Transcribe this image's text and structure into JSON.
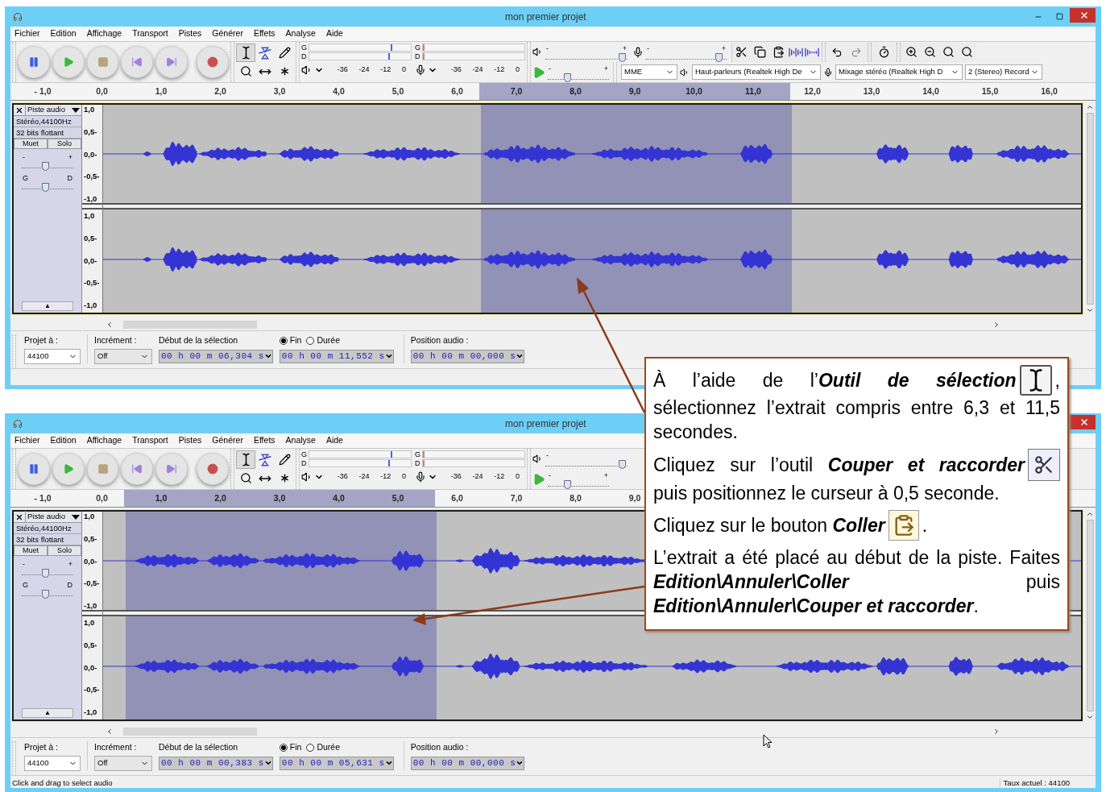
{
  "windows": [
    {
      "title": "mon premier projet",
      "controls": [
        {
          "kind": "minimize"
        },
        {
          "kind": "maximize"
        },
        {
          "kind": "close"
        }
      ],
      "menu": [
        "Fichier",
        "Edition",
        "Affichage",
        "Transport",
        "Pistes",
        "Générer",
        "Effets",
        "Analyse",
        "Aide"
      ],
      "tools": [
        {
          "kind": "select",
          "selected": true
        },
        {
          "kind": "envelope",
          "selected": false
        },
        {
          "kind": "draw",
          "selected": false
        },
        {
          "kind": "zoom",
          "selected": false
        },
        {
          "kind": "timeshift",
          "selected": false
        },
        {
          "kind": "multi",
          "selected": false
        }
      ],
      "meters": [
        {
          "kind": "playback",
          "channels": [
            {
              "label": "G",
              "level": 0.8
            },
            {
              "label": "D",
              "level": 0.78
            }
          ],
          "ticks": [
            "-36",
            "-24",
            "-12",
            "0"
          ]
        },
        {
          "kind": "record",
          "channels": [
            {
              "label": "G",
              "level": 0
            },
            {
              "label": "D",
              "level": 0
            }
          ],
          "ticks": [
            "-36",
            "-24",
            "-12",
            "0"
          ]
        }
      ],
      "mixer": [
        {
          "kind": "output",
          "min": "-",
          "max": "+",
          "level": 0.93
        },
        {
          "kind": "input",
          "min": "-",
          "max": "+",
          "level": 0.9
        }
      ],
      "edit_toolbars": true,
      "speed": {
        "min": "-",
        "max": "+",
        "level": 0.32
      },
      "devices": [
        {
          "kind": "host",
          "value": "MME"
        },
        {
          "kind": "output",
          "value": "Haut-parleurs (Realtek High De"
        },
        {
          "kind": "input",
          "value": "Mixage stéréo (Realtek High D"
        },
        {
          "kind": "channels",
          "value": "2 (Stereo) Record"
        }
      ],
      "ruler": [
        {
          "label": "- 1,0",
          "selected": false
        },
        {
          "label": "0,0",
          "selected": false
        },
        {
          "label": "1,0",
          "selected": false
        },
        {
          "label": "2,0",
          "selected": false
        },
        {
          "label": "3,0",
          "selected": false
        },
        {
          "label": "4,0",
          "selected": false
        },
        {
          "label": "5,0",
          "selected": false
        },
        {
          "label": "6,0",
          "selected": false
        },
        {
          "label": "7,0",
          "selected": true
        },
        {
          "label": "8,0",
          "selected": true
        },
        {
          "label": "9,0",
          "selected": true
        },
        {
          "label": "10,0",
          "selected": true
        },
        {
          "label": "11,0",
          "selected": true
        },
        {
          "label": "12,0",
          "selected": false
        },
        {
          "label": "13,0",
          "selected": false
        },
        {
          "label": "14,0",
          "selected": false
        },
        {
          "label": "15,0",
          "selected": false
        },
        {
          "label": "16,0",
          "selected": false
        }
      ],
      "track": {
        "name": "Piste audio",
        "info": [
          "Stéréo,44100Hz",
          "32 bits flottant"
        ],
        "buttons": [
          "Muet",
          "Solo"
        ],
        "gain": {
          "min": "-",
          "max": "+",
          "level": 0.45
        },
        "pan": {
          "min": "G",
          "max": "D",
          "level": 0.45
        },
        "collapse": "▲",
        "scale": [
          [
            "1,0",
            "0,5-",
            "0,0-",
            "-0,5-",
            "-1,0"
          ],
          [
            "1,0",
            "0,5-",
            "0,0-",
            "-0,5-",
            "-1,0"
          ]
        ]
      },
      "selection_bar": {
        "rate_label": "Projet à :",
        "rate": "44100",
        "snap_label": "Incrément :",
        "snap": "Off",
        "start_label": "Début de la sélection",
        "start": "00 h 00 m 06,304 s",
        "end_options": [
          {
            "label": "Fin",
            "selected": true
          },
          {
            "label": "Durée",
            "selected": false
          }
        ],
        "end": "00 h 00 m 11,552 s",
        "position_label": "Position audio :",
        "position": "00 h 00 m 00,000 s"
      }
    },
    {
      "title": "mon premier projet",
      "controls": [
        {
          "kind": "close"
        }
      ],
      "menu": [
        "Fichier",
        "Edition",
        "Affichage",
        "Transport",
        "Pistes",
        "Générer",
        "Effets",
        "Analyse",
        "Aide"
      ],
      "tools": [
        {
          "kind": "select",
          "selected": true
        },
        {
          "kind": "envelope",
          "selected": false
        },
        {
          "kind": "draw",
          "selected": false
        },
        {
          "kind": "zoom",
          "selected": false
        },
        {
          "kind": "timeshift",
          "selected": false
        },
        {
          "kind": "multi",
          "selected": false
        }
      ],
      "meters": [
        {
          "kind": "playback",
          "channels": [
            {
              "label": "G",
              "level": 0.8
            },
            {
              "label": "D",
              "level": 0.78
            }
          ],
          "ticks": [
            "-36",
            "-24",
            "-12",
            "0"
          ]
        },
        {
          "kind": "record",
          "channels": [
            {
              "label": "G",
              "level": 0
            },
            {
              "label": "D",
              "level": 0
            }
          ],
          "ticks": [
            "-36",
            "-24",
            "-12",
            "0"
          ]
        }
      ],
      "mixer": [
        {
          "kind": "output",
          "min": "-",
          "level": 0.93
        }
      ],
      "edit_toolbars": false,
      "speed": {
        "min": "-",
        "max": "+",
        "level": 0.32
      },
      "ruler": [
        {
          "label": "- 1,0",
          "selected": false
        },
        {
          "label": "0,0",
          "selected": false
        },
        {
          "label": "1,0",
          "selected": true
        },
        {
          "label": "2,0",
          "selected": true
        },
        {
          "label": "3,0",
          "selected": true
        },
        {
          "label": "4,0",
          "selected": true
        },
        {
          "label": "5,0",
          "selected": true
        },
        {
          "label": "6,0",
          "selected": false
        },
        {
          "label": "7,0",
          "selected": false
        },
        {
          "label": "8,0",
          "selected": false
        },
        {
          "label": "9,0",
          "selected": false
        }
      ],
      "track": {
        "name": "Piste audio",
        "info": [
          "Stéréo,44100Hz",
          "32 bits flottant"
        ],
        "buttons": [
          "Muet",
          "Solo"
        ],
        "gain": {
          "min": "-",
          "max": "+",
          "level": 0.45
        },
        "pan": {
          "min": "G",
          "max": "D",
          "level": 0.45
        },
        "collapse": "▲",
        "scale": [
          [
            "1,0",
            "0,5-",
            "0,0-",
            "-0,5-",
            "-1,0"
          ],
          [
            "1,0",
            "0,5-",
            "0,0-",
            "-0,5-",
            "-1,0"
          ]
        ]
      },
      "selection_bar": {
        "rate_label": "Projet à :",
        "rate": "44100",
        "snap_label": "Incrément :",
        "snap": "Off",
        "start_label": "Début de la sélection",
        "start": "00 h 00 m 00,383 s",
        "end_options": [
          {
            "label": "Fin",
            "selected": true
          },
          {
            "label": "Durée",
            "selected": false
          }
        ],
        "end": "00 h 00 m 05,631 s",
        "position_label": "Position audio :",
        "position": "00 h 00 m 00,000 s"
      },
      "status": [
        "Click and drag to select audio",
        "Taux actuel : 44100"
      ]
    }
  ],
  "callout": [
    {
      "lead": "À l’aide de l’**Outil de sélection**",
      "after": ",",
      "body": "sélectionnez l’extrait compris entre 6,3 et 11,5 secondes."
    },
    {
      "lead": "Cliquez sur l’outil **Couper et raccorder**",
      "body": "puis positionnez le curseur à 0,5 seconde."
    },
    {
      "lead": "Cliquez sur le bouton **Coller**",
      "after": "."
    },
    {
      "body": "L’extrait a été placé au début de la piste. Faites **Edition\\Annuler\\Coller** puis **Edition\\Annuler\\Couper et raccorder**."
    }
  ]
}
